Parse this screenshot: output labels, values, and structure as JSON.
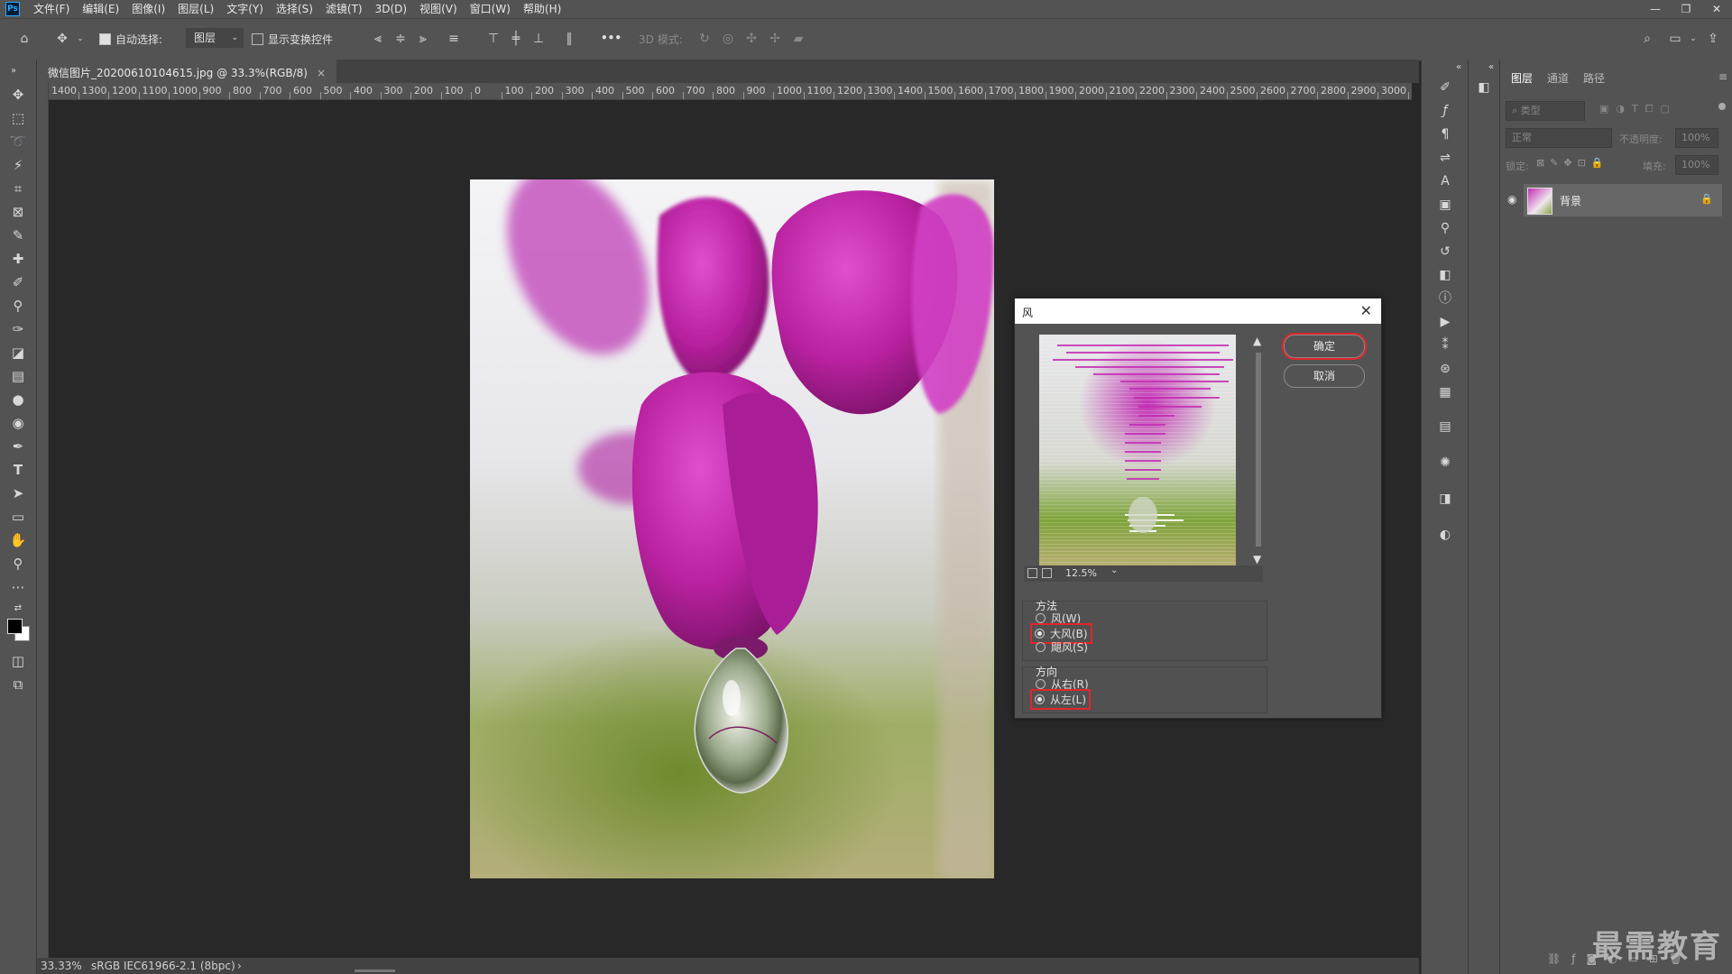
{
  "app": {
    "logo_text": "Ps",
    "menu": [
      "文件(F)",
      "编辑(E)",
      "图像(I)",
      "图层(L)",
      "文字(Y)",
      "选择(S)",
      "滤镜(T)",
      "3D(D)",
      "视图(V)",
      "窗口(W)",
      "帮助(H)"
    ],
    "window_controls": [
      "—",
      "❐",
      "✕"
    ]
  },
  "options_bar": {
    "auto_select_label": "自动选择:",
    "auto_select_checked": true,
    "layer_select_value": "图层",
    "show_transform_label": "显示变换控件",
    "show_transform_checked": false,
    "mode_3d_label": "3D 模式:",
    "more_label": "•••"
  },
  "document": {
    "tab_title": "微信图片_20200610104615.jpg @ 33.3%(RGB/8)",
    "tab_close": "×",
    "ruler_labels": [
      "1400",
      "1300",
      "1200",
      "1100",
      "1000",
      "900",
      "800",
      "700",
      "600",
      "500",
      "400",
      "300",
      "200",
      "100",
      "0",
      "100",
      "200",
      "300",
      "400",
      "500",
      "600",
      "700",
      "800",
      "900",
      "1000",
      "1100",
      "1200",
      "1300",
      "1400",
      "1500",
      "1600",
      "1700",
      "1800",
      "1900",
      "2000",
      "2100",
      "2200",
      "2300",
      "2400",
      "2500",
      "2600",
      "2700",
      "2800",
      "2900",
      "3000",
      "3"
    ]
  },
  "status_bar": {
    "zoom": "33.33%",
    "profile": "sRGB IEC61966-2.1 (8bpc)",
    "arrow": "›"
  },
  "layers_panel": {
    "tabs": [
      "图层",
      "通道",
      "路径"
    ],
    "active_tab": 0,
    "filter_placeholder": "类型",
    "blend_mode": "正常",
    "opacity_label": "不透明度:",
    "opacity_value": "100%",
    "lock_label": "锁定:",
    "fill_label": "填充:",
    "fill_value": "100%",
    "layers": [
      {
        "name": "背景",
        "visible": true,
        "locked": true
      }
    ]
  },
  "dialog": {
    "title": "风",
    "close": "✕",
    "ok_label": "确定",
    "cancel_label": "取消",
    "zoom_value": "12.5%",
    "method_title": "方法",
    "method_options": [
      "风(W)",
      "大风(B)",
      "飓风(S)"
    ],
    "method_selected": 1,
    "direction_title": "方向",
    "direction_options": [
      "从右(R)",
      "从左(L)"
    ],
    "direction_selected": 1
  },
  "watermark": "最需教育",
  "colors": {
    "highlight": "#e0262b",
    "panel": "#535353",
    "canvas": "#282828",
    "flower": "#c22fb4"
  }
}
